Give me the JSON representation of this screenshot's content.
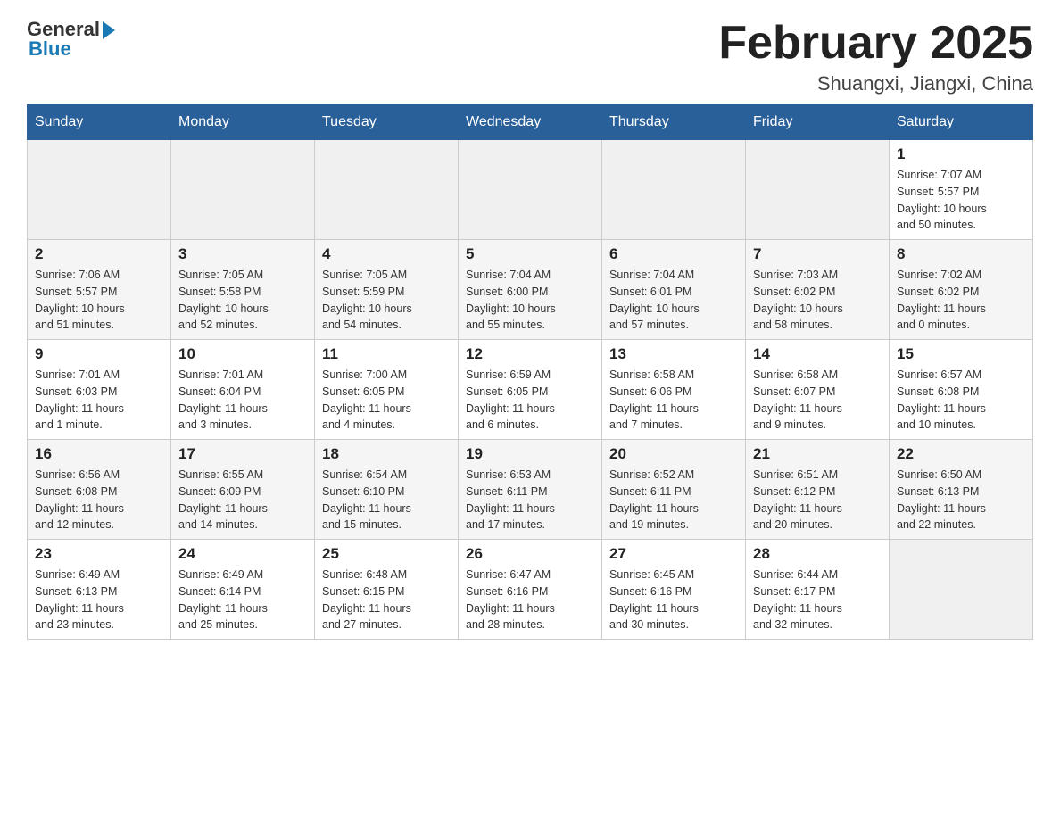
{
  "header": {
    "logo_general": "General",
    "logo_blue": "Blue",
    "month_title": "February 2025",
    "location": "Shuangxi, Jiangxi, China"
  },
  "weekdays": [
    "Sunday",
    "Monday",
    "Tuesday",
    "Wednesday",
    "Thursday",
    "Friday",
    "Saturday"
  ],
  "rows": [
    {
      "cells": [
        {
          "day": "",
          "info": ""
        },
        {
          "day": "",
          "info": ""
        },
        {
          "day": "",
          "info": ""
        },
        {
          "day": "",
          "info": ""
        },
        {
          "day": "",
          "info": ""
        },
        {
          "day": "",
          "info": ""
        },
        {
          "day": "1",
          "info": "Sunrise: 7:07 AM\nSunset: 5:57 PM\nDaylight: 10 hours\nand 50 minutes."
        }
      ]
    },
    {
      "cells": [
        {
          "day": "2",
          "info": "Sunrise: 7:06 AM\nSunset: 5:57 PM\nDaylight: 10 hours\nand 51 minutes."
        },
        {
          "day": "3",
          "info": "Sunrise: 7:05 AM\nSunset: 5:58 PM\nDaylight: 10 hours\nand 52 minutes."
        },
        {
          "day": "4",
          "info": "Sunrise: 7:05 AM\nSunset: 5:59 PM\nDaylight: 10 hours\nand 54 minutes."
        },
        {
          "day": "5",
          "info": "Sunrise: 7:04 AM\nSunset: 6:00 PM\nDaylight: 10 hours\nand 55 minutes."
        },
        {
          "day": "6",
          "info": "Sunrise: 7:04 AM\nSunset: 6:01 PM\nDaylight: 10 hours\nand 57 minutes."
        },
        {
          "day": "7",
          "info": "Sunrise: 7:03 AM\nSunset: 6:02 PM\nDaylight: 10 hours\nand 58 minutes."
        },
        {
          "day": "8",
          "info": "Sunrise: 7:02 AM\nSunset: 6:02 PM\nDaylight: 11 hours\nand 0 minutes."
        }
      ]
    },
    {
      "cells": [
        {
          "day": "9",
          "info": "Sunrise: 7:01 AM\nSunset: 6:03 PM\nDaylight: 11 hours\nand 1 minute."
        },
        {
          "day": "10",
          "info": "Sunrise: 7:01 AM\nSunset: 6:04 PM\nDaylight: 11 hours\nand 3 minutes."
        },
        {
          "day": "11",
          "info": "Sunrise: 7:00 AM\nSunset: 6:05 PM\nDaylight: 11 hours\nand 4 minutes."
        },
        {
          "day": "12",
          "info": "Sunrise: 6:59 AM\nSunset: 6:05 PM\nDaylight: 11 hours\nand 6 minutes."
        },
        {
          "day": "13",
          "info": "Sunrise: 6:58 AM\nSunset: 6:06 PM\nDaylight: 11 hours\nand 7 minutes."
        },
        {
          "day": "14",
          "info": "Sunrise: 6:58 AM\nSunset: 6:07 PM\nDaylight: 11 hours\nand 9 minutes."
        },
        {
          "day": "15",
          "info": "Sunrise: 6:57 AM\nSunset: 6:08 PM\nDaylight: 11 hours\nand 10 minutes."
        }
      ]
    },
    {
      "cells": [
        {
          "day": "16",
          "info": "Sunrise: 6:56 AM\nSunset: 6:08 PM\nDaylight: 11 hours\nand 12 minutes."
        },
        {
          "day": "17",
          "info": "Sunrise: 6:55 AM\nSunset: 6:09 PM\nDaylight: 11 hours\nand 14 minutes."
        },
        {
          "day": "18",
          "info": "Sunrise: 6:54 AM\nSunset: 6:10 PM\nDaylight: 11 hours\nand 15 minutes."
        },
        {
          "day": "19",
          "info": "Sunrise: 6:53 AM\nSunset: 6:11 PM\nDaylight: 11 hours\nand 17 minutes."
        },
        {
          "day": "20",
          "info": "Sunrise: 6:52 AM\nSunset: 6:11 PM\nDaylight: 11 hours\nand 19 minutes."
        },
        {
          "day": "21",
          "info": "Sunrise: 6:51 AM\nSunset: 6:12 PM\nDaylight: 11 hours\nand 20 minutes."
        },
        {
          "day": "22",
          "info": "Sunrise: 6:50 AM\nSunset: 6:13 PM\nDaylight: 11 hours\nand 22 minutes."
        }
      ]
    },
    {
      "cells": [
        {
          "day": "23",
          "info": "Sunrise: 6:49 AM\nSunset: 6:13 PM\nDaylight: 11 hours\nand 23 minutes."
        },
        {
          "day": "24",
          "info": "Sunrise: 6:49 AM\nSunset: 6:14 PM\nDaylight: 11 hours\nand 25 minutes."
        },
        {
          "day": "25",
          "info": "Sunrise: 6:48 AM\nSunset: 6:15 PM\nDaylight: 11 hours\nand 27 minutes."
        },
        {
          "day": "26",
          "info": "Sunrise: 6:47 AM\nSunset: 6:16 PM\nDaylight: 11 hours\nand 28 minutes."
        },
        {
          "day": "27",
          "info": "Sunrise: 6:45 AM\nSunset: 6:16 PM\nDaylight: 11 hours\nand 30 minutes."
        },
        {
          "day": "28",
          "info": "Sunrise: 6:44 AM\nSunset: 6:17 PM\nDaylight: 11 hours\nand 32 minutes."
        },
        {
          "day": "",
          "info": ""
        }
      ]
    }
  ]
}
